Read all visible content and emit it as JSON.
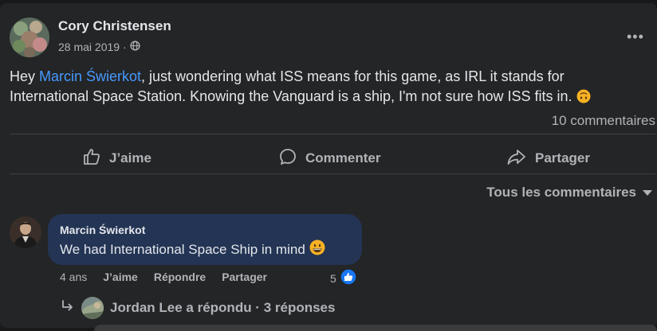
{
  "post": {
    "author": "Cory Christensen",
    "date": "28 mai 2019 ·",
    "audience_icon": "globe-icon",
    "more_label": "•••",
    "text_prefix": "Hey ",
    "mention": "Marcin Świerkot",
    "text_rest": ", just wondering what ISS means for this game, as IRL it stands for International Space Station. Knowing the Vanguard is a ship, I'm not sure how ISS fits in.",
    "emoji": "upside-down-face-emoji",
    "comment_count": "10 commentaires"
  },
  "actions": {
    "like": "J’aime",
    "comment": "Commenter",
    "share": "Partager"
  },
  "comments_filter": {
    "label": "Tous les commentaires",
    "icon": "caret-down-icon"
  },
  "comment": {
    "author": "Marcin Świerkot",
    "text": "We had International Space Ship in mind",
    "emoji": "grinning-face-emoji",
    "time": "4 ans",
    "like": "J’aime",
    "reply": "Répondre",
    "share": "Partager",
    "reaction_count": "5",
    "reaction_icon": "like-reaction-icon"
  },
  "replies": {
    "text": "Jordan Lee a répondu · 3 réponses",
    "icon": "reply-arrow-icon"
  },
  "colors": {
    "background": "#18191a",
    "card": "#242526",
    "bubble": "#233454",
    "link": "#4599ff",
    "secondary_text": "#b0b3b8",
    "like_blue": "#1877f2"
  }
}
